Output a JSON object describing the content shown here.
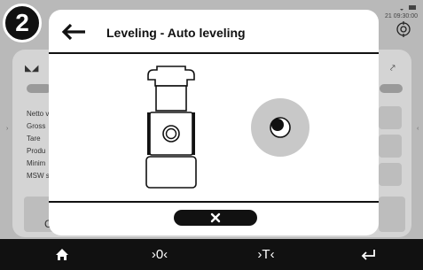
{
  "badge": {
    "number": "2"
  },
  "status": {
    "time": "21  09:30:00",
    "icons": "wifi-icon battery-icon"
  },
  "background": {
    "labels": [
      "Netto v",
      "Gross",
      "Tare",
      "Produ",
      "Minim",
      "MSW s"
    ],
    "partial_letter": "C"
  },
  "modal": {
    "title": "Leveling - Auto leveling",
    "close_icon": "close-icon"
  },
  "bottom_bar": {
    "home_icon": "home-icon",
    "zero_label": "›0‹",
    "tare_label": "›T‹",
    "enter_icon": "enter-icon"
  },
  "colors": {
    "modal_bg": "#ffffff",
    "bottom_bar": "#111111",
    "level_circle": "#c8c8c8",
    "background_panel": "#d4d4d4"
  }
}
